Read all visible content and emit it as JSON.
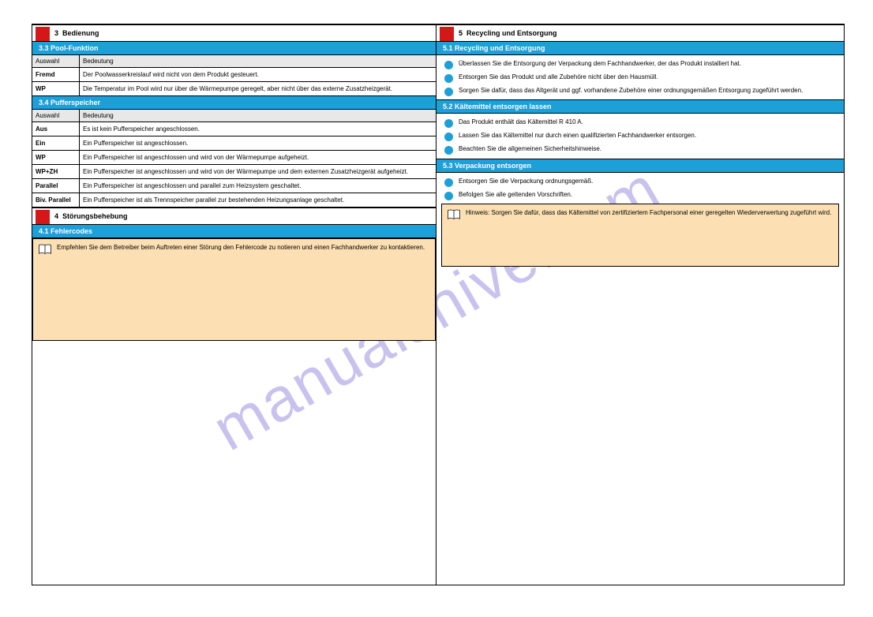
{
  "watermark": "manualshive.com",
  "left": {
    "section3": {
      "number": "3",
      "title": "Bedienung",
      "bar": "3.3   Pool-Funktion",
      "header": {
        "a": "Auswahl",
        "b": "Bedeutung"
      },
      "rows": [
        {
          "a": "Fremd",
          "b": "Der Poolwasserkreislauf wird nicht von dem Produkt gesteuert."
        },
        {
          "a": "WP",
          "b": "Die Temperatur im Pool wird nur über die Wärmepumpe geregelt, aber nicht über das externe Zusatzheizgerät."
        }
      ]
    },
    "table2": {
      "bar": "3.4   Pufferspeicher",
      "header": {
        "a": "Auswahl",
        "b": "Bedeutung"
      },
      "rows": [
        {
          "a": "Aus",
          "b": "Es ist kein Pufferspeicher angeschlossen."
        },
        {
          "a": "Ein",
          "b": "Ein Pufferspeicher ist angeschlossen."
        },
        {
          "a": "WP",
          "b": "Ein Pufferspeicher ist angeschlossen und wird von der Wärmepumpe aufgeheizt."
        },
        {
          "a": "WP+ZH",
          "b": "Ein Pufferspeicher ist angeschlossen und wird von der Wärmepumpe und dem externen Zusatzheizgerät aufgeheizt."
        },
        {
          "a": "Parallel",
          "b": "Ein Pufferspeicher ist angeschlossen und parallel zum Heizsystem geschaltet."
        },
        {
          "a": "Biv. Parallel",
          "b": "Ein Pufferspeicher ist als Trennspeicher parallel zur bestehenden Heizungsanlage geschaltet."
        }
      ]
    },
    "section4": {
      "number": "4",
      "title": "Störungsbehebung",
      "bar": "4.1   Fehlercodes",
      "note": "Empfehlen Sie dem Betreiber beim Auftreten einer Störung den Fehlercode zu notieren und einen Fachhandwerker zu kontaktieren."
    }
  },
  "right": {
    "section5": {
      "number": "5",
      "title": "Recycling und Entsorgung",
      "list1": {
        "title": "5.1   Recycling und Entsorgung",
        "items": [
          "Überlassen Sie die Entsorgung der Verpackung dem Fachhandwerker, der das Produkt installiert hat.",
          "Entsorgen Sie das Produkt und alle Zubehöre nicht über den Hausmüll.",
          "Sorgen Sie dafür, dass das Altgerät und ggf. vorhandene Zubehöre einer ordnungsgemäßen Entsorgung zugeführt werden."
        ]
      },
      "list2": {
        "title": "5.2   Kältemittel entsorgen lassen",
        "items": [
          "Das Produkt enthält das Kältemittel R 410 A.",
          "Lassen Sie das Kältemittel nur durch einen qualifizierten Fachhandwerker entsorgen.",
          "Beachten Sie die allgemeinen Sicherheitshinweise."
        ]
      },
      "list3": {
        "title": "5.3   Verpackung entsorgen",
        "items": [
          "Entsorgen Sie die Verpackung ordnungsgemäß.",
          "Befolgen Sie alle geltenden Vorschriften."
        ]
      },
      "note": "Hinweis: Sorgen Sie dafür, dass das Kältemittel von zertifiziertem Fachpersonal einer geregelten Wiederverwertung zugeführt wird."
    }
  }
}
